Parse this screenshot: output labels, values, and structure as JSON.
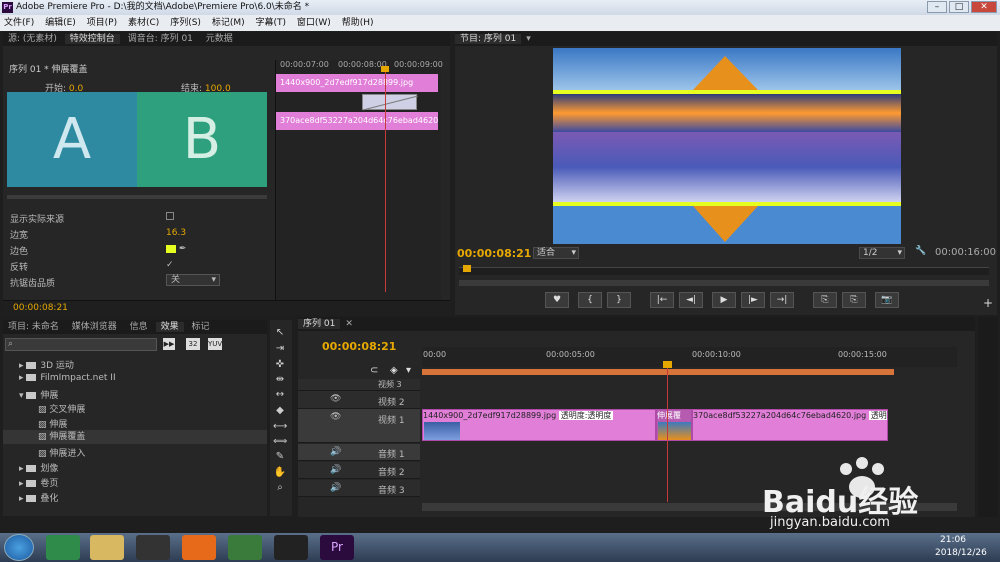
{
  "window": {
    "title": "Adobe Premiere Pro - D:\\我的文档\\Adobe\\Premiere Pro\\6.0\\未命名 *",
    "app_icon": "Pr"
  },
  "menu": [
    "文件(F)",
    "编辑(E)",
    "项目(P)",
    "素材(C)",
    "序列(S)",
    "标记(M)",
    "字幕(T)",
    "窗口(W)",
    "帮助(H)"
  ],
  "source_panel": {
    "tabs": [
      "源: (无素材)",
      "特效控制台",
      "调音台: 序列 01",
      "元数据"
    ],
    "seq_label": "序列 01 * 伸展覆盖",
    "start_label": "开始:",
    "start_value": "0.0",
    "end_label": "结束:",
    "end_value": "100.0",
    "preview_a": "A",
    "preview_b": "B",
    "ruler": [
      "00:00:07:00",
      "00:00:08:00",
      "00:00:09:00"
    ],
    "clip1": "1440x900_2d7edf917d28899.jpg",
    "clip2": "370ace8df53227a204d64c76ebad4620.jpg",
    "props": [
      {
        "label": "显示实际来源",
        "value": ""
      },
      {
        "label": "边宽",
        "value": "16.3"
      },
      {
        "label": "边色",
        "value": ""
      },
      {
        "label": "反转",
        "value": "✓"
      },
      {
        "label": "抗锯齿品质",
        "value": "关"
      }
    ],
    "timecode": "00:00:08:21",
    "border_color": "#e6ff20"
  },
  "program_panel": {
    "tab": "节目: 序列 01",
    "timecode": "00:00:08:21",
    "fit": "适合",
    "resolution": "1/2",
    "duration": "00:00:16:00"
  },
  "transport": [
    "♥",
    "{",
    "}",
    "|←",
    "◄|",
    "▶",
    "|►",
    "→|",
    "⎘",
    "⎘",
    "📷"
  ],
  "project_panel": {
    "tabs": [
      "项目: 未命名",
      "媒体浏览器",
      "信息",
      "效果",
      "标记"
    ],
    "items": [
      {
        "label": "3D 运动",
        "type": "folder",
        "indent": 1
      },
      {
        "label": "FilmImpact.net II",
        "type": "folder",
        "indent": 1
      },
      {
        "label": "伸展",
        "type": "folder",
        "indent": 1
      },
      {
        "label": "交叉伸展",
        "type": "fx",
        "indent": 2
      },
      {
        "label": "伸展",
        "type": "fx",
        "indent": 2
      },
      {
        "label": "伸展覆盖",
        "type": "fx",
        "indent": 2
      },
      {
        "label": "伸展进入",
        "type": "fx",
        "indent": 2
      },
      {
        "label": "划像",
        "type": "folder",
        "indent": 1
      },
      {
        "label": "卷页",
        "type": "folder",
        "indent": 1
      },
      {
        "label": "叠化",
        "type": "folder",
        "indent": 1
      }
    ]
  },
  "timeline": {
    "tab": "序列 01",
    "timecode": "00:00:08:21",
    "ruler": [
      "00:00",
      "00:00:05:00",
      "00:00:10:00",
      "00:00:15:00"
    ],
    "tracks": [
      {
        "name": "视频 3"
      },
      {
        "name": "视频 2"
      },
      {
        "name": "视频 1"
      },
      {
        "name": "音频 1"
      },
      {
        "name": "音频 2"
      },
      {
        "name": "音频 3"
      }
    ],
    "clip1": "1440x900_2d7edf917d28899.jpg",
    "clip1_fx": "透明度:透明度",
    "transition": "伸展覆",
    "clip2": "370ace8df53227a204d64c76ebad4620.jpg",
    "clip2_fx": "透明度:透明度"
  },
  "taskbar": {
    "time": "21:06",
    "date": "2018/12/26"
  },
  "watermark": {
    "brand": "Baidu经验",
    "url": "jingyan.baidu.com"
  }
}
